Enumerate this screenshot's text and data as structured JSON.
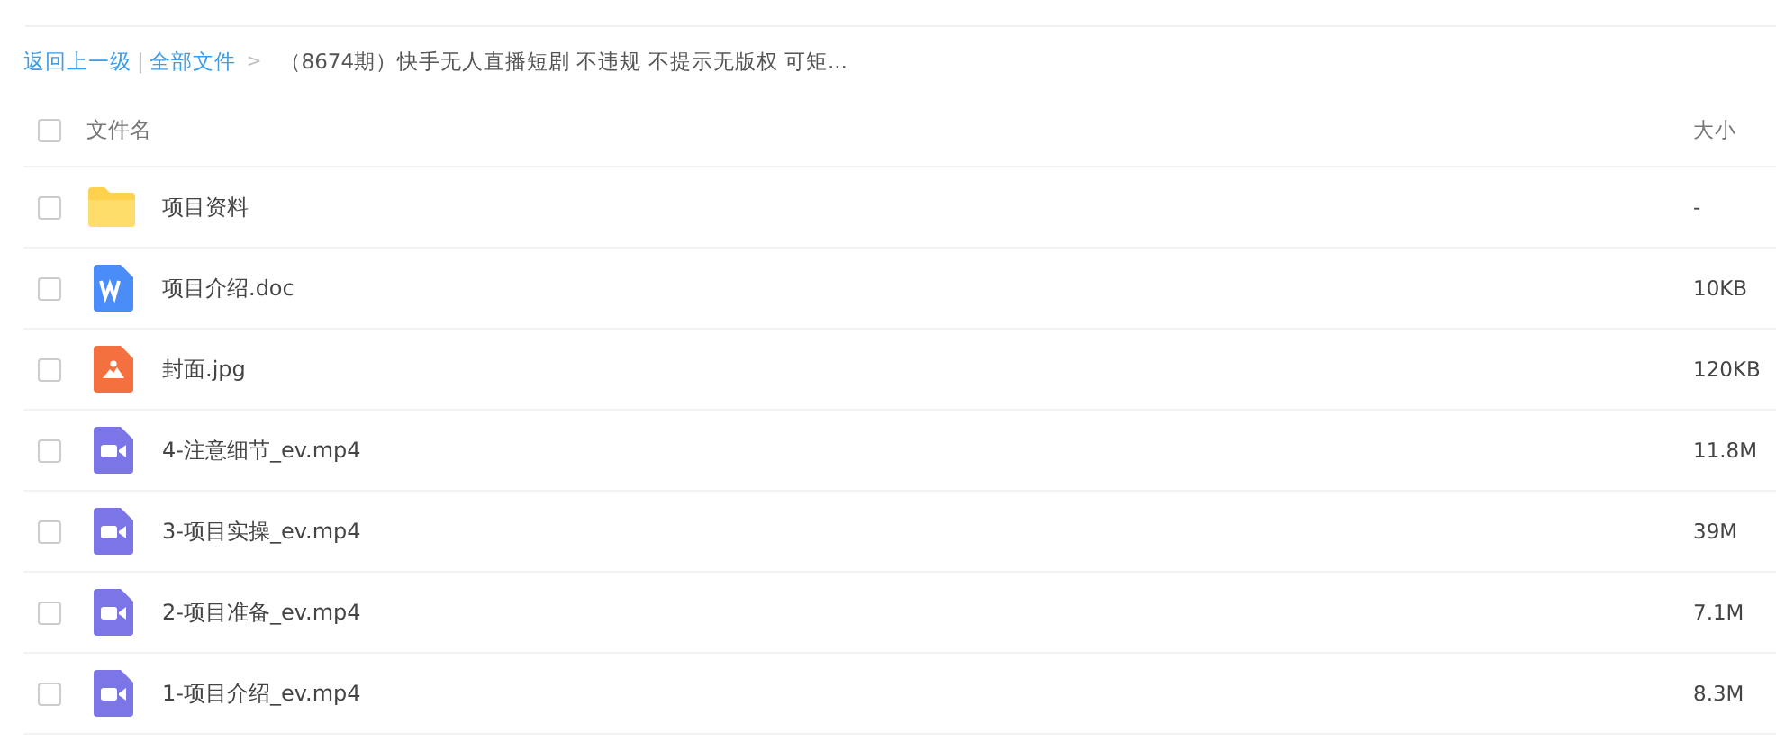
{
  "breadcrumb": {
    "back": "返回上一级",
    "divider": "|",
    "root": "全部文件",
    "arrow": ">",
    "current": "（8674期）快手无人直播短剧  不违规 不提示无版权 可矩..."
  },
  "table": {
    "columns": [
      "文件名",
      "大小"
    ],
    "header_checked": false,
    "rows": [
      {
        "kind": "folder",
        "name": "项目资料",
        "size": "-",
        "checked": false
      },
      {
        "kind": "doc",
        "name": "项目介绍.doc",
        "size": "10KB",
        "checked": false
      },
      {
        "kind": "image",
        "name": "封面.jpg",
        "size": "120KB",
        "checked": false
      },
      {
        "kind": "video",
        "name": "4-注意细节_ev.mp4",
        "size": "11.8M",
        "checked": false
      },
      {
        "kind": "video",
        "name": "3-项目实操_ev.mp4",
        "size": "39M",
        "checked": false
      },
      {
        "kind": "video",
        "name": "2-项目准备_ev.mp4",
        "size": "7.1M",
        "checked": false
      },
      {
        "kind": "video",
        "name": "1-项目介绍_ev.mp4",
        "size": "8.3M",
        "checked": false
      }
    ]
  }
}
